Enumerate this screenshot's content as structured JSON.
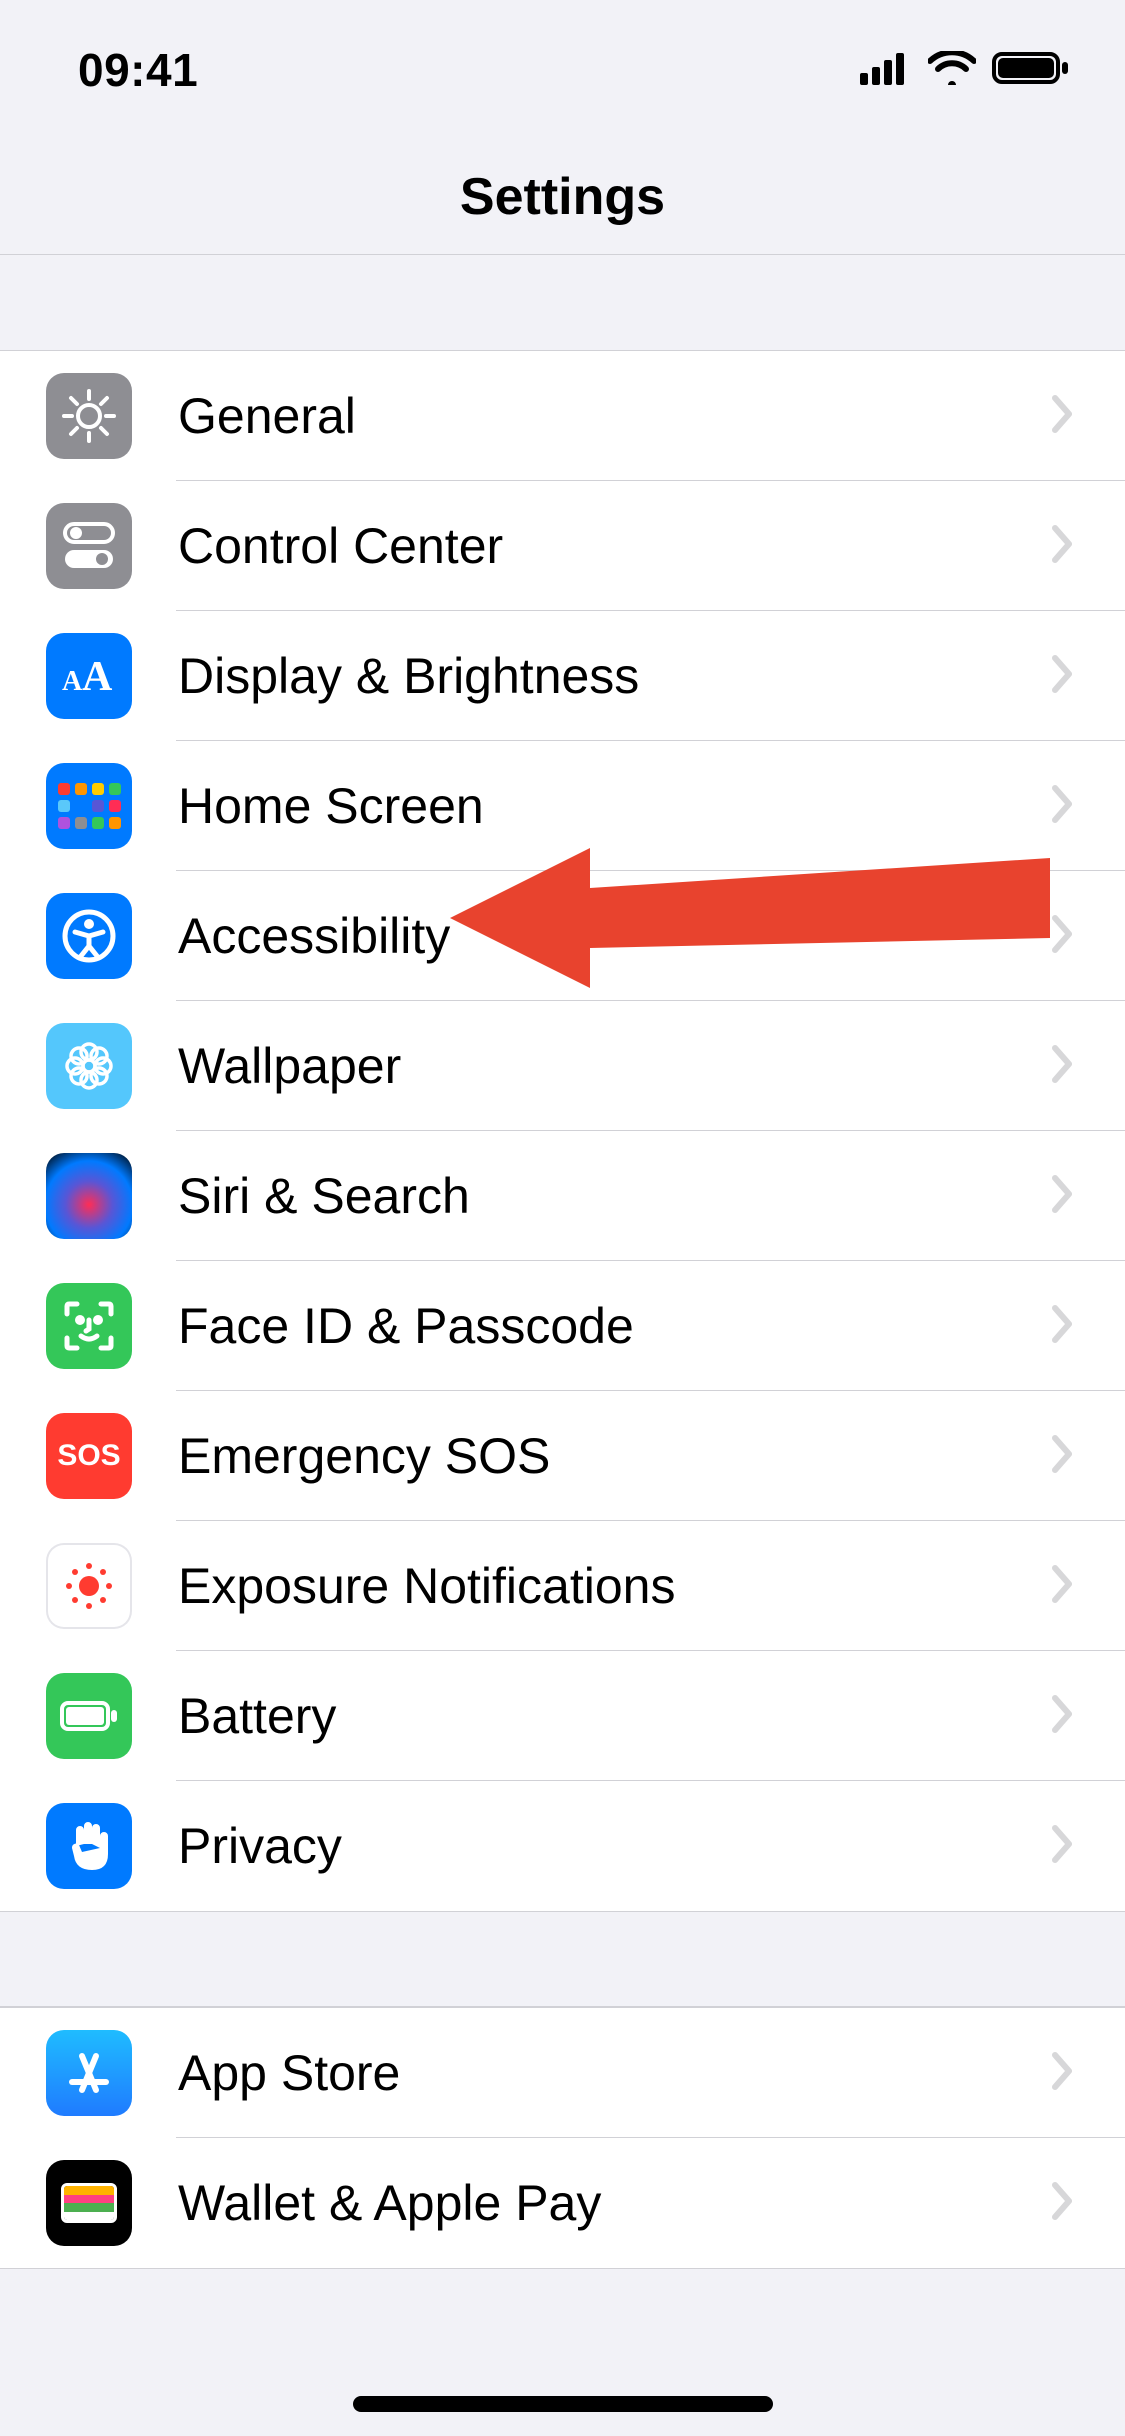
{
  "statusbar": {
    "time": "09:41"
  },
  "navbar": {
    "title": "Settings"
  },
  "groups": [
    {
      "items": [
        {
          "id": "general",
          "label": "General"
        },
        {
          "id": "control-center",
          "label": "Control Center"
        },
        {
          "id": "display-brightness",
          "label": "Display & Brightness"
        },
        {
          "id": "home-screen",
          "label": "Home Screen"
        },
        {
          "id": "accessibility",
          "label": "Accessibility"
        },
        {
          "id": "wallpaper",
          "label": "Wallpaper"
        },
        {
          "id": "siri-search",
          "label": "Siri & Search"
        },
        {
          "id": "faceid-passcode",
          "label": "Face ID & Passcode"
        },
        {
          "id": "emergency-sos",
          "label": "Emergency SOS",
          "icon_text": "SOS"
        },
        {
          "id": "exposure-notifications",
          "label": "Exposure Notifications"
        },
        {
          "id": "battery",
          "label": "Battery"
        },
        {
          "id": "privacy",
          "label": "Privacy"
        }
      ]
    },
    {
      "items": [
        {
          "id": "app-store",
          "label": "App Store"
        },
        {
          "id": "wallet-apple-pay",
          "label": "Wallet & Apple Pay"
        }
      ]
    }
  ],
  "annotation": {
    "target": "accessibility"
  }
}
